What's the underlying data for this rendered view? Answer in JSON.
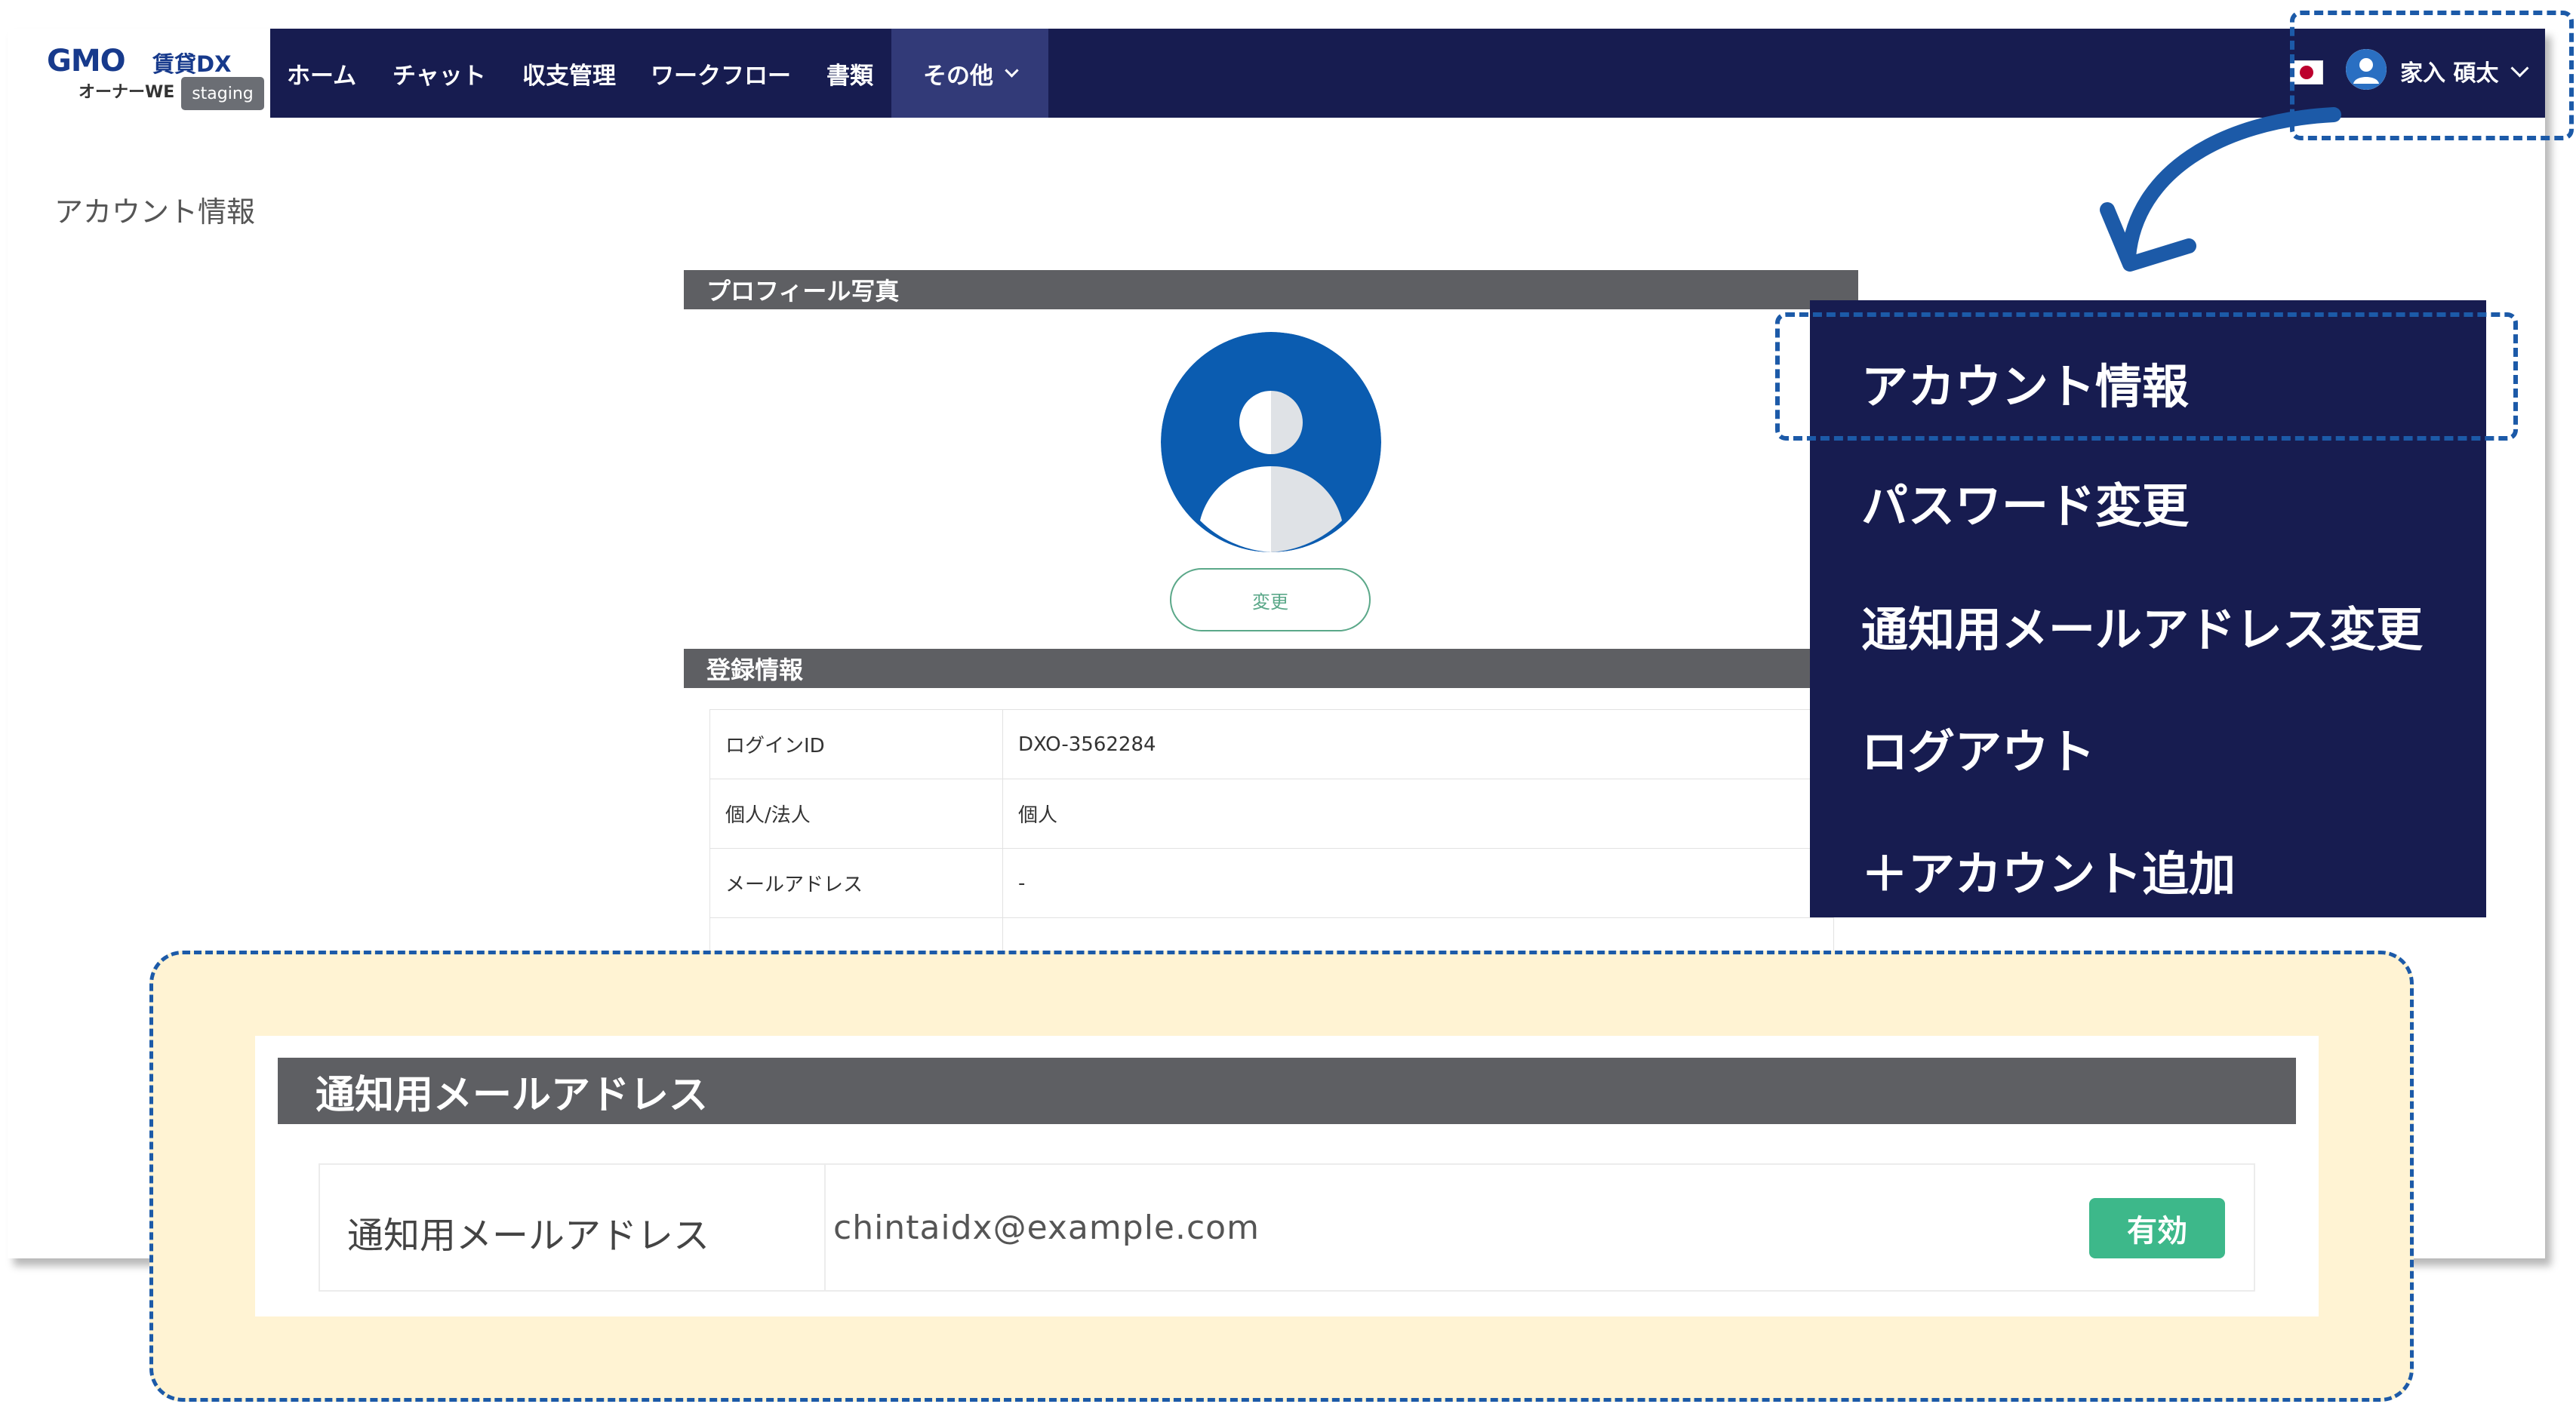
{
  "app": {
    "logo_brand": "GMO",
    "logo_product": "賃貸DX",
    "logo_sub": "オーナーWE",
    "env_badge": "staging"
  },
  "nav": {
    "items": [
      "ホーム",
      "チャット",
      "収支管理",
      "ワークフロー",
      "書類"
    ],
    "other_label": "その他"
  },
  "user": {
    "name": "家入 碩太",
    "flag_icon": "japan-flag-icon"
  },
  "page": {
    "title": "アカウント情報"
  },
  "profile_photo": {
    "header": "プロフィール写真",
    "change_label": "変更"
  },
  "registration": {
    "header": "登録情報",
    "rows": [
      {
        "label": "ログインID",
        "value": "DXO-3562284"
      },
      {
        "label": "個人/法人",
        "value": "個人"
      },
      {
        "label": "メールアドレス",
        "value": "-"
      }
    ]
  },
  "user_menu": {
    "items": [
      "アカウント情報",
      "パスワード変更",
      "通知用メールアドレス変更",
      "ログアウト",
      "＋アカウント追加"
    ]
  },
  "notification_email": {
    "header": "通知用メールアドレス",
    "label": "通知用メールアドレス",
    "value": "chintaidx@example.com",
    "status": "有効"
  },
  "colors": {
    "navbar": "#171c50",
    "accent_blue": "#1c5aa8",
    "status_green": "#3db88a",
    "highlight_bg": "#fff3d3"
  }
}
